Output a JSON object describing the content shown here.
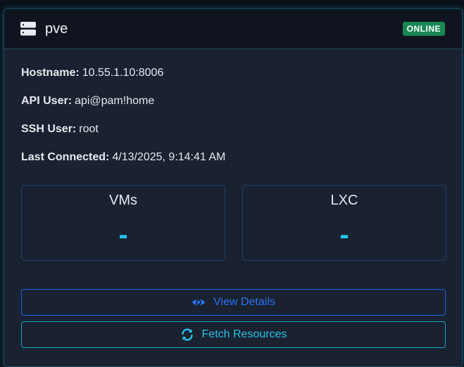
{
  "header": {
    "server_icon": "server-icon",
    "node_name": "pve",
    "status": "ONLINE",
    "status_color": "#198754"
  },
  "info": {
    "hostname_label": "Hostname:",
    "hostname_value": "10.55.1.10:8006",
    "api_user_label": "API User:",
    "api_user_value": "api@pam!home",
    "ssh_user_label": "SSH User:",
    "ssh_user_value": "root",
    "last_connected_label": "Last Connected:",
    "last_connected_value": "4/13/2025, 9:14:41 AM"
  },
  "stats": {
    "vms_title": "VMs",
    "vms_value": "-",
    "lxc_title": "LXC",
    "lxc_value": "-"
  },
  "actions": {
    "view_details_label": "View Details",
    "view_details_icon": "eye-icon",
    "fetch_resources_label": "Fetch Resources",
    "fetch_resources_icon": "refresh-icon"
  },
  "colors": {
    "accent": "#1fc4ec",
    "primary": "#2a73f5",
    "card_bg": "#1a2130",
    "header_bg": "#0f141e"
  }
}
